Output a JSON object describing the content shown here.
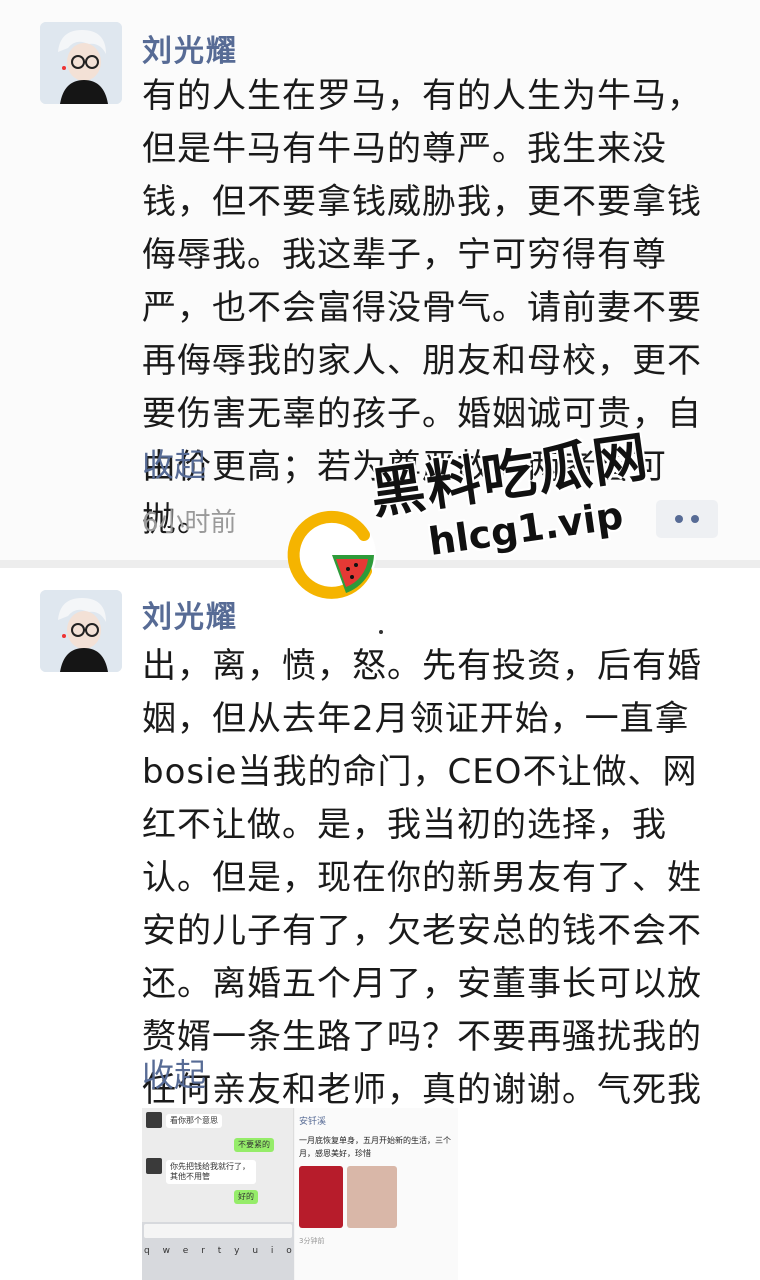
{
  "posts": [
    {
      "author": "刘光耀",
      "content": "有的人生在罗马，有的人生为牛马，但是牛马有牛马的尊严。我生来没钱，但不要拿钱威胁我，更不要拿钱侮辱我。我这辈子，宁可穷得有尊严，也不会富得没骨气。请前妻不要再侮辱我的家人、朋友和母校，更不要伤害无辜的孩子。婚姻诚可贵，自由价更高；若为尊严故，两者皆可抛。",
      "collapse_label": "收起",
      "timestamp": "6小时前",
      "more_icon": "more-dots-icon"
    },
    {
      "author": "刘光耀",
      "content": "出，离，愤，怒。先有投资，后有婚姻，但从去年2月领证开始，一直拿bosie当我的命门，CEO不让做、网红不让做。是，我当初的选择，我认。但是，现在你的新男友有了、姓安的儿子有了，欠老安总的钱不会不还。离婚五个月了，安董事长可以放赘婿一条生路了吗？不要再骚扰我的任何亲友和老师，真的谢谢。气死我了。",
      "collapse_label": "收起",
      "attachment": {
        "chat_messages": [
          "看你那个意思",
          "不要紧的",
          "你先把钱给我就行了，其他不用管",
          "好的"
        ],
        "keyboard_row": "q w e r t y u i o p",
        "profile_name": "安钎溪",
        "profile_text": "一月底恢复单身，五月开始新的生活，三个月，感恩美好，珍惜",
        "post_time": "3分钟前"
      }
    }
  ],
  "watermark": {
    "title": "黑料吃瓜网",
    "url": "hlcg1.vip",
    "logo_colors": {
      "ring": "#f5b400",
      "melon_green": "#2e9b3a",
      "melon_red": "#e53935"
    }
  },
  "colors": {
    "link_blue": "#576b95",
    "time_gray": "#9a9a9a",
    "divider": "#ededed"
  }
}
